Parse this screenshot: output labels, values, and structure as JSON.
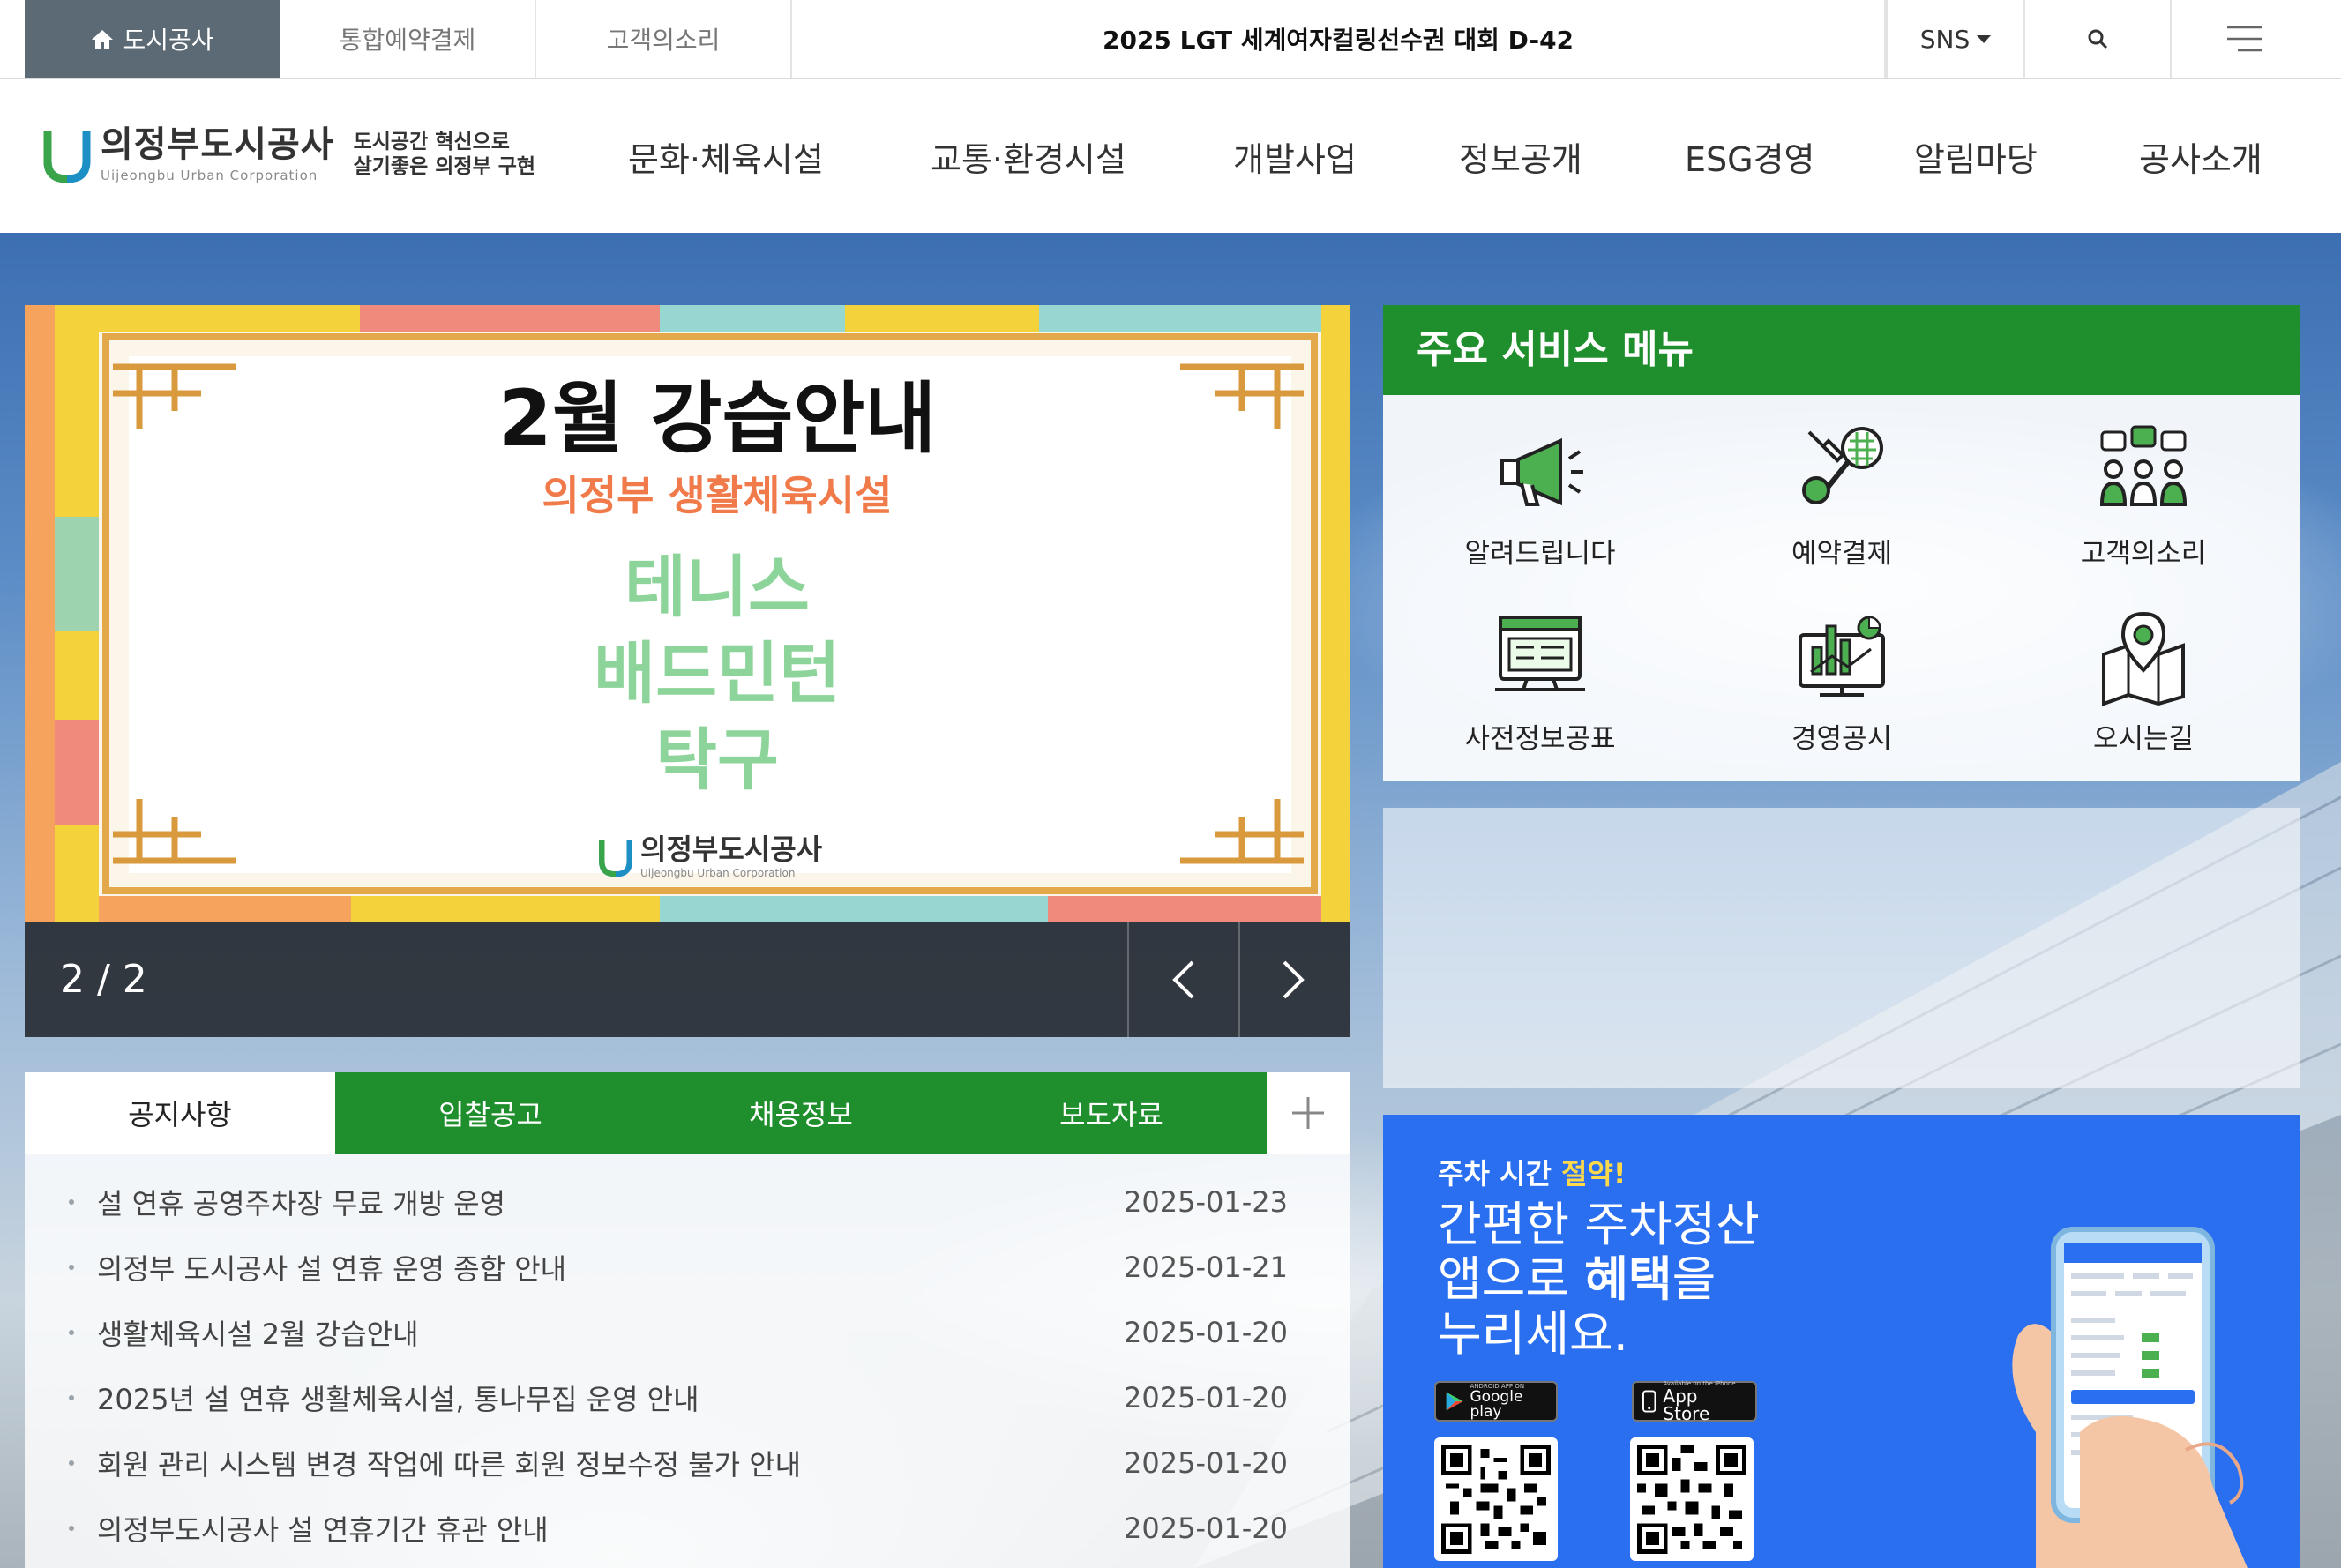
{
  "topbar": {
    "home_label": "도시공사",
    "booking_label": "통합예약결제",
    "voice_label": "고객의소리",
    "ticker_text": "2025 LGT 세계여자컬링선수권 대회 D-42",
    "sns_label": "SNS"
  },
  "header": {
    "logo_name": "의정부도시공사",
    "logo_eng": "Uijeongbu Urban Corporation",
    "slogan_line1": "도시공간 혁신으로",
    "slogan_line2": "살기좋은 의정부 구현",
    "nav": [
      "문화·체육시설",
      "교통·환경시설",
      "개발사업",
      "정보공개",
      "ESG경영",
      "알림마당",
      "공사소개"
    ]
  },
  "banner": {
    "title": "2월 강습안내",
    "subtitle": "의정부 생활체육시설",
    "sports": [
      "테니스",
      "배드민턴",
      "탁구"
    ],
    "logo_name": "의정부도시공사",
    "logo_eng": "Uijeongbu Urban Corporation",
    "counter": "2 / 2"
  },
  "board": {
    "tabs": [
      "공지사항",
      "입찰공고",
      "채용정보",
      "보도자료"
    ],
    "notices": [
      {
        "title": "설 연휴 공영주차장 무료 개방 운영",
        "date": "2025-01-23"
      },
      {
        "title": "의정부 도시공사 설 연휴 운영 종합 안내",
        "date": "2025-01-21"
      },
      {
        "title": "생활체육시설 2월 강습안내",
        "date": "2025-01-20"
      },
      {
        "title": "2025년 설 연휴 생활체육시설, 통나무집 운영 안내",
        "date": "2025-01-20"
      },
      {
        "title": "회원 관리 시스템 변경 작업에 따른 회원 정보수정 불가 안내",
        "date": "2025-01-20"
      },
      {
        "title": "의정부도시공사 설 연휴기간 휴관 안내",
        "date": "2025-01-20"
      }
    ]
  },
  "service": {
    "title": "주요 서비스 메뉴",
    "items": [
      {
        "label": "알려드립니다",
        "icon": "megaphone-icon"
      },
      {
        "label": "예약결제",
        "icon": "sports-rackets-icon"
      },
      {
        "label": "고객의소리",
        "icon": "customer-group-icon"
      },
      {
        "label": "사전정보공표",
        "icon": "monitor-list-icon"
      },
      {
        "label": "경영공시",
        "icon": "chart-monitor-icon"
      },
      {
        "label": "오시는길",
        "icon": "map-pin-icon"
      }
    ]
  },
  "promo": {
    "small_plain": "주차 시간 ",
    "small_accent": "절약!",
    "line1": "간편한 주차정산",
    "line2_a": "앱으로 ",
    "line2_b": "혜택",
    "line2_c": "을",
    "line3": "누리세요.",
    "google_small": "ANDROID APP ON",
    "google_label": "Google play",
    "apple_small": "Available on the iPhone",
    "apple_label": "App Store"
  },
  "colors": {
    "green": "#1f8e2c",
    "home_gray": "#5b6a74",
    "promo_blue": "#2a6ff0",
    "accent_yellow": "#ffd94a"
  }
}
